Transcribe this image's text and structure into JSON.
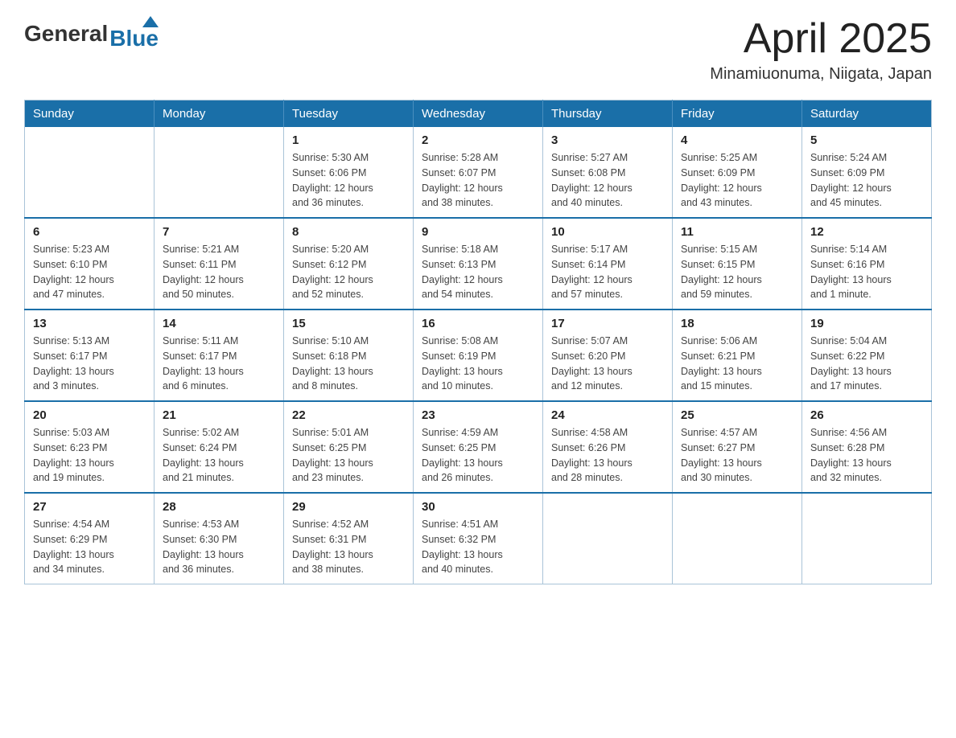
{
  "header": {
    "logo_general": "General",
    "logo_blue": "Blue",
    "month_title": "April 2025",
    "location": "Minamiuonuma, Niigata, Japan"
  },
  "weekdays": [
    "Sunday",
    "Monday",
    "Tuesday",
    "Wednesday",
    "Thursday",
    "Friday",
    "Saturday"
  ],
  "weeks": [
    [
      {
        "day": "",
        "info": ""
      },
      {
        "day": "",
        "info": ""
      },
      {
        "day": "1",
        "info": "Sunrise: 5:30 AM\nSunset: 6:06 PM\nDaylight: 12 hours\nand 36 minutes."
      },
      {
        "day": "2",
        "info": "Sunrise: 5:28 AM\nSunset: 6:07 PM\nDaylight: 12 hours\nand 38 minutes."
      },
      {
        "day": "3",
        "info": "Sunrise: 5:27 AM\nSunset: 6:08 PM\nDaylight: 12 hours\nand 40 minutes."
      },
      {
        "day": "4",
        "info": "Sunrise: 5:25 AM\nSunset: 6:09 PM\nDaylight: 12 hours\nand 43 minutes."
      },
      {
        "day": "5",
        "info": "Sunrise: 5:24 AM\nSunset: 6:09 PM\nDaylight: 12 hours\nand 45 minutes."
      }
    ],
    [
      {
        "day": "6",
        "info": "Sunrise: 5:23 AM\nSunset: 6:10 PM\nDaylight: 12 hours\nand 47 minutes."
      },
      {
        "day": "7",
        "info": "Sunrise: 5:21 AM\nSunset: 6:11 PM\nDaylight: 12 hours\nand 50 minutes."
      },
      {
        "day": "8",
        "info": "Sunrise: 5:20 AM\nSunset: 6:12 PM\nDaylight: 12 hours\nand 52 minutes."
      },
      {
        "day": "9",
        "info": "Sunrise: 5:18 AM\nSunset: 6:13 PM\nDaylight: 12 hours\nand 54 minutes."
      },
      {
        "day": "10",
        "info": "Sunrise: 5:17 AM\nSunset: 6:14 PM\nDaylight: 12 hours\nand 57 minutes."
      },
      {
        "day": "11",
        "info": "Sunrise: 5:15 AM\nSunset: 6:15 PM\nDaylight: 12 hours\nand 59 minutes."
      },
      {
        "day": "12",
        "info": "Sunrise: 5:14 AM\nSunset: 6:16 PM\nDaylight: 13 hours\nand 1 minute."
      }
    ],
    [
      {
        "day": "13",
        "info": "Sunrise: 5:13 AM\nSunset: 6:17 PM\nDaylight: 13 hours\nand 3 minutes."
      },
      {
        "day": "14",
        "info": "Sunrise: 5:11 AM\nSunset: 6:17 PM\nDaylight: 13 hours\nand 6 minutes."
      },
      {
        "day": "15",
        "info": "Sunrise: 5:10 AM\nSunset: 6:18 PM\nDaylight: 13 hours\nand 8 minutes."
      },
      {
        "day": "16",
        "info": "Sunrise: 5:08 AM\nSunset: 6:19 PM\nDaylight: 13 hours\nand 10 minutes."
      },
      {
        "day": "17",
        "info": "Sunrise: 5:07 AM\nSunset: 6:20 PM\nDaylight: 13 hours\nand 12 minutes."
      },
      {
        "day": "18",
        "info": "Sunrise: 5:06 AM\nSunset: 6:21 PM\nDaylight: 13 hours\nand 15 minutes."
      },
      {
        "day": "19",
        "info": "Sunrise: 5:04 AM\nSunset: 6:22 PM\nDaylight: 13 hours\nand 17 minutes."
      }
    ],
    [
      {
        "day": "20",
        "info": "Sunrise: 5:03 AM\nSunset: 6:23 PM\nDaylight: 13 hours\nand 19 minutes."
      },
      {
        "day": "21",
        "info": "Sunrise: 5:02 AM\nSunset: 6:24 PM\nDaylight: 13 hours\nand 21 minutes."
      },
      {
        "day": "22",
        "info": "Sunrise: 5:01 AM\nSunset: 6:25 PM\nDaylight: 13 hours\nand 23 minutes."
      },
      {
        "day": "23",
        "info": "Sunrise: 4:59 AM\nSunset: 6:25 PM\nDaylight: 13 hours\nand 26 minutes."
      },
      {
        "day": "24",
        "info": "Sunrise: 4:58 AM\nSunset: 6:26 PM\nDaylight: 13 hours\nand 28 minutes."
      },
      {
        "day": "25",
        "info": "Sunrise: 4:57 AM\nSunset: 6:27 PM\nDaylight: 13 hours\nand 30 minutes."
      },
      {
        "day": "26",
        "info": "Sunrise: 4:56 AM\nSunset: 6:28 PM\nDaylight: 13 hours\nand 32 minutes."
      }
    ],
    [
      {
        "day": "27",
        "info": "Sunrise: 4:54 AM\nSunset: 6:29 PM\nDaylight: 13 hours\nand 34 minutes."
      },
      {
        "day": "28",
        "info": "Sunrise: 4:53 AM\nSunset: 6:30 PM\nDaylight: 13 hours\nand 36 minutes."
      },
      {
        "day": "29",
        "info": "Sunrise: 4:52 AM\nSunset: 6:31 PM\nDaylight: 13 hours\nand 38 minutes."
      },
      {
        "day": "30",
        "info": "Sunrise: 4:51 AM\nSunset: 6:32 PM\nDaylight: 13 hours\nand 40 minutes."
      },
      {
        "day": "",
        "info": ""
      },
      {
        "day": "",
        "info": ""
      },
      {
        "day": "",
        "info": ""
      }
    ]
  ]
}
